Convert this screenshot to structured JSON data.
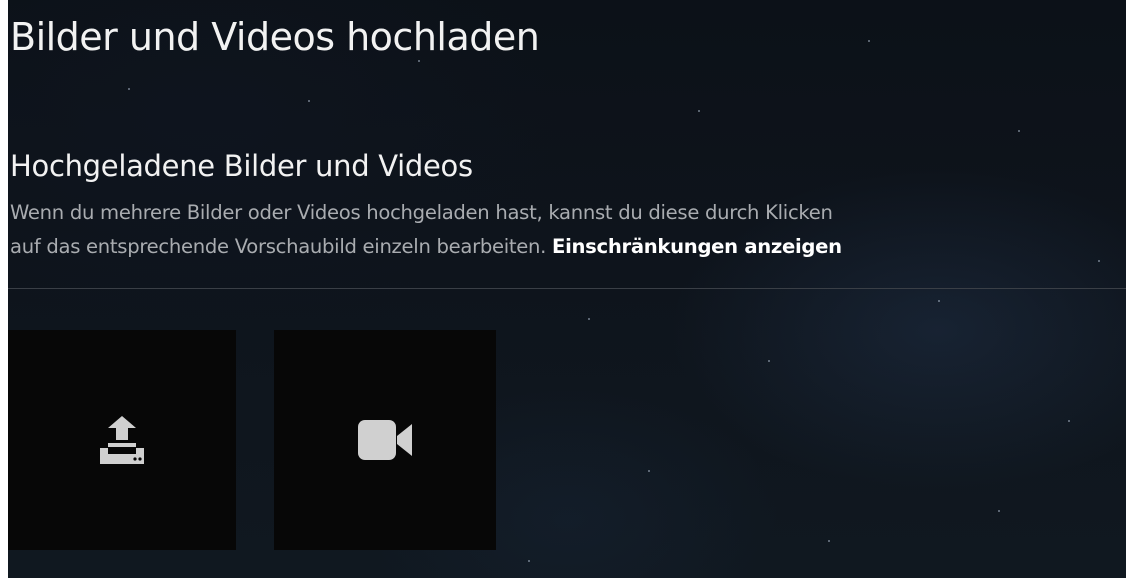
{
  "page": {
    "title": "Bilder und Videos hochladen"
  },
  "uploaded_section": {
    "title": "Hochgeladene Bilder und Videos",
    "description_line1": "Wenn du mehrere Bilder oder Videos hochgeladen hast, kannst du diese durch Klicken",
    "description_line2": "auf das entsprechende Vorschaubild einzeln bearbeiten.",
    "restrictions_link": "Einschränkungen anzeigen"
  },
  "tiles": [
    {
      "name": "upload-tile",
      "icon": "upload-icon"
    },
    {
      "name": "video-tile",
      "icon": "video-camera-icon"
    }
  ],
  "colors": {
    "background": "#0e141c",
    "heading_text": "#f2f2f2",
    "body_text": "#a9acb0",
    "link_text": "#ffffff",
    "tile_background": "#070707",
    "icon_color": "#d0d0d0"
  }
}
